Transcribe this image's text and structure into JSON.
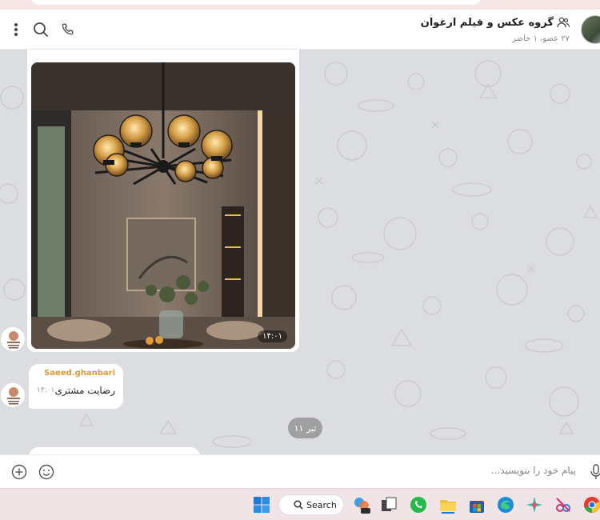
{
  "header": {
    "title": "گروه عکس و فیلم ارغوان",
    "subtitle": "۲۷ عضو، ۱ حاضر"
  },
  "messages": {
    "photo_time": "۱۴:۰۱",
    "text_sender": "Saeed.ghanbari",
    "text_body": "رضایت مشتری",
    "text_time": "۱۴:۰۱",
    "date_separator": "۱۱ تیر"
  },
  "composer": {
    "placeholder": "پیام خود را بنویسید..."
  },
  "taskbar": {
    "search_label": "Search"
  },
  "colors": {
    "chat_bg": "#dcdde1",
    "sender_color": "#d99a34",
    "accent": "#3390ec"
  }
}
